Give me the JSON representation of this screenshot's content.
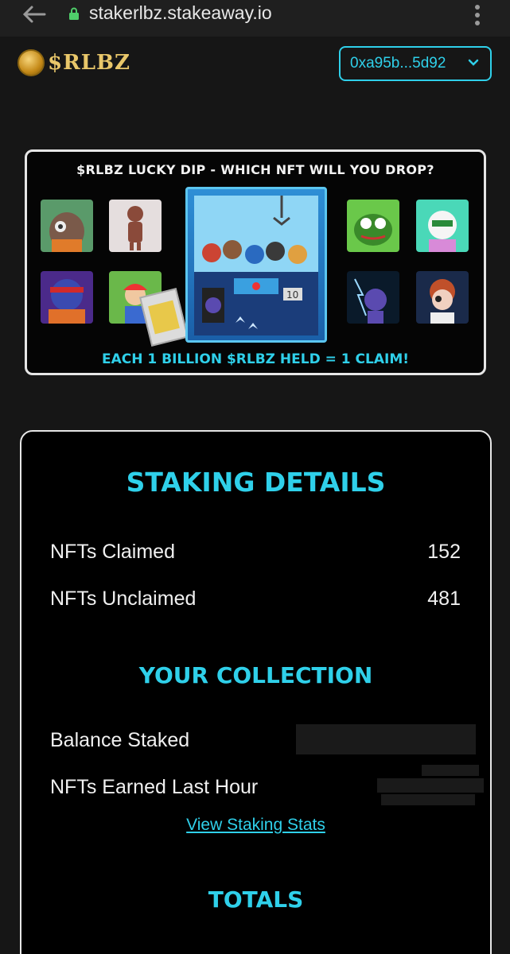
{
  "browser": {
    "url": "stakerlbz.stakeaway.io"
  },
  "header": {
    "logo_text": "$RLBZ",
    "wallet_address": "0xa95b...5d92"
  },
  "banner": {
    "title": "$RLBZ LUCKY DIP - WHICH NFT WILL YOU DROP?",
    "footer": "EACH 1 BILLION $RLBZ HELD = 1 CLAIM!",
    "machine_tag": "10"
  },
  "staking": {
    "title": "STAKING DETAILS",
    "rows": [
      {
        "label": "NFTs Claimed",
        "value": "152"
      },
      {
        "label": "NFTs Unclaimed",
        "value": "481"
      }
    ]
  },
  "collection": {
    "title": "YOUR COLLECTION",
    "rows": [
      {
        "label": "Balance Staked"
      },
      {
        "label": "NFTs Earned Last Hour"
      }
    ],
    "link": "View Staking Stats"
  },
  "totals": {
    "title": "TOTALS"
  },
  "colors": {
    "accent": "#2fd0ea",
    "background": "#161616",
    "card": "#000000",
    "border": "#e6e6e6"
  },
  "icons": [
    "back-arrow-icon",
    "lock-icon",
    "kebab-menu-icon",
    "coin-logo-icon",
    "chevron-down-icon"
  ]
}
